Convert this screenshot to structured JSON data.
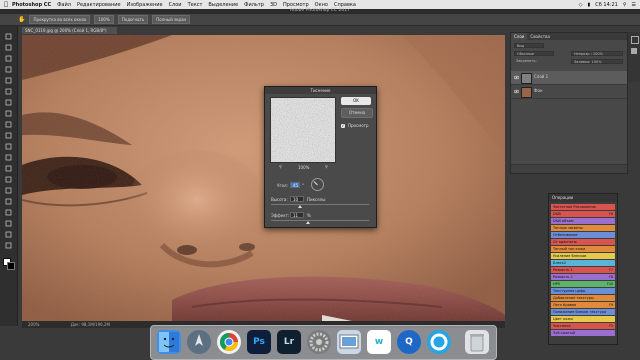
{
  "menubar": {
    "app": "Photoshop CC",
    "items": [
      "Файл",
      "Редактирование",
      "Изображение",
      "Слои",
      "Текст",
      "Выделение",
      "Фильтр",
      "3D",
      "Просмотр",
      "Окно",
      "Справка"
    ],
    "time": "Сб 14:21"
  },
  "window": {
    "title": "Adobe Photoshop CC 2017"
  },
  "options_bar": {
    "scroll_all": "Прокрутка во всех окнах",
    "zoom": "100%",
    "fit_screen": "Подогнать",
    "fill_screen": "Полный экран"
  },
  "document": {
    "tab": "SNC_0119.jpg @ 200% (Слой 1, RGB/8*)",
    "status_zoom": "200%",
    "status_doc": "Док: 98,1M/196,2M"
  },
  "layers_panel": {
    "tabs": [
      "Слои",
      "Свойства"
    ],
    "kind_label": "Вид",
    "blend_mode": "Обычные",
    "opacity": "Непрозр.: 100%",
    "lock": "Закрепить:",
    "fill": "Заливка: 100%",
    "layers": [
      {
        "name": "Слой 1",
        "selected": true
      },
      {
        "name": "Фон",
        "selected": false
      }
    ]
  },
  "dialog": {
    "title": "Тиснение",
    "ok": "OK",
    "cancel": "Отмена",
    "preview_label": "Просмотр",
    "preview_checked": true,
    "zoom": "100%",
    "angle_label": "Угол:",
    "angle_value": "45",
    "angle_unit": "°",
    "height_label": "Высота:",
    "height_value": "10",
    "height_unit": "Пикселы",
    "effect_label": "Эффект:",
    "effect_value": "11",
    "effect_unit": "%"
  },
  "actions_panel": {
    "title": "Операции",
    "items": [
      {
        "label": "Частотное Разложение",
        "key": "",
        "color": "#d9534f"
      },
      {
        "label": "D&B",
        "key": "F6",
        "color": "#d9534f"
      },
      {
        "label": "D&B объем",
        "key": "",
        "color": "#9a6fd0"
      },
      {
        "label": "Теплые засветы",
        "key": "",
        "color": "#e08a3c"
      },
      {
        "label": "Отбеливание",
        "key": "",
        "color": "#6a8fd8"
      },
      {
        "label": "От красноты",
        "key": "",
        "color": "#d9534f"
      },
      {
        "label": "Теплый тон кожи",
        "key": "",
        "color": "#e08a3c"
      },
      {
        "label": "Усиление блесков",
        "key": "",
        "color": "#e6c84a"
      },
      {
        "label": "Блеск2",
        "key": "",
        "color": "#5ab4d9"
      },
      {
        "label": "Резкость 1",
        "key": "F7",
        "color": "#d9534f"
      },
      {
        "label": "Резкость 2",
        "key": "F8",
        "color": "#9a6fd0"
      },
      {
        "label": "HPS",
        "key": "F10",
        "color": "#5ab46a"
      },
      {
        "label": "Текстурная цифр.",
        "key": "",
        "color": "#6a8fd8"
      },
      {
        "label": "Добавление текстуры",
        "key": "",
        "color": "#e08a3c"
      },
      {
        "label": "Лого Кривая",
        "key": "F9",
        "color": "#e08a3c"
      },
      {
        "label": "Понижение блеков текстура",
        "key": "",
        "color": "#6a8fd8"
      },
      {
        "label": "Цвет кожи",
        "key": "",
        "color": "#e6c84a"
      },
      {
        "label": "Чистинка",
        "key": "F5",
        "color": "#d9534f"
      },
      {
        "label": "Зуб.сжатый",
        "key": "",
        "color": "#9a6fd0"
      }
    ]
  },
  "dock": {
    "apps": [
      {
        "label": "",
        "icon": "finder-icon",
        "bg": "#3e8ee6",
        "fg": "#fff"
      },
      {
        "label": "",
        "icon": "launchpad-icon",
        "bg": "#5d6f82",
        "fg": "#fff"
      },
      {
        "label": "",
        "icon": "chrome-icon",
        "bg": "#f2f2f2",
        "fg": "#d04436"
      },
      {
        "label": "Ps",
        "icon": "photoshop-icon",
        "bg": "#0d1f3a",
        "fg": "#31a8ff"
      },
      {
        "label": "Lr",
        "icon": "lightroom-icon",
        "bg": "#101f2e",
        "fg": "#b9dcf3"
      },
      {
        "label": "",
        "icon": "system-preferences-icon",
        "bg": "#7b7b7b",
        "fg": "#ddd"
      },
      {
        "label": "",
        "icon": "preview-icon",
        "bg": "#c9d8e8",
        "fg": "#2c5a8a"
      },
      {
        "label": "w",
        "icon": "wunderlist-icon",
        "bg": "#ffffff",
        "fg": "#1fb1c7"
      },
      {
        "label": "Q",
        "icon": "quicktime-icon",
        "bg": "#1e67c7",
        "fg": "#fff"
      },
      {
        "label": "",
        "icon": "app-circle-icon",
        "bg": "#26a5e4",
        "fg": "#fff"
      },
      {
        "label": "",
        "icon": "trash-icon",
        "bg": "#dfe3e6",
        "fg": "#666"
      }
    ]
  }
}
